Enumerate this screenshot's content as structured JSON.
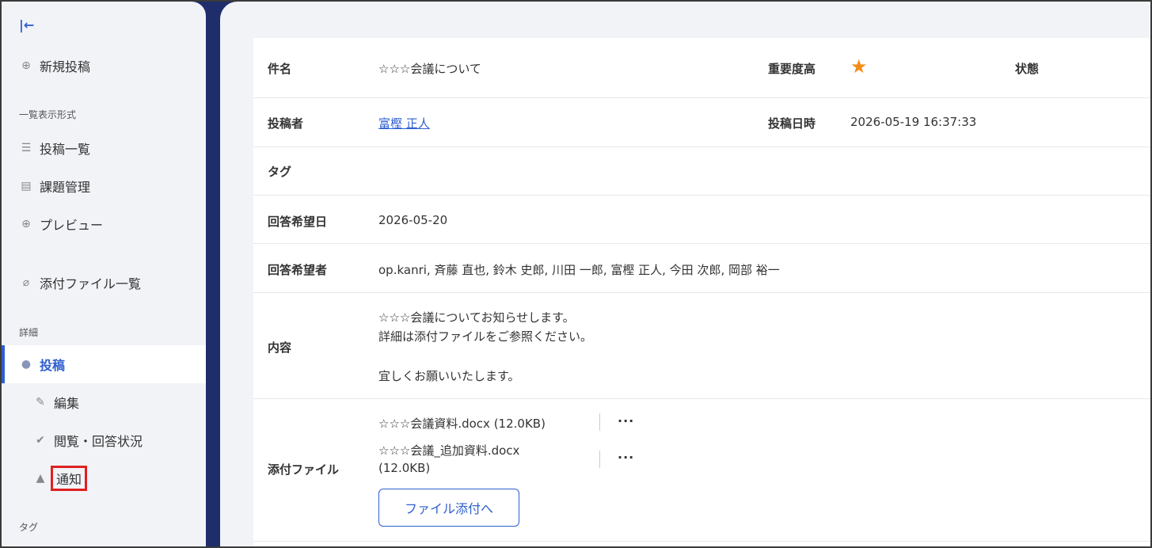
{
  "sidebar": {
    "collapse_icon": "collapse-left-icon",
    "new_post": "新規投稿",
    "section_list_format": "一覧表示形式",
    "post_list": "投稿一覧",
    "task_management": "課題管理",
    "preview": "プレビュー",
    "attachment_list": "添付ファイル一覧",
    "section_details": "詳細",
    "post": "投稿",
    "edit": "編集",
    "read_status": "閲覧・回答状況",
    "notification": "通知",
    "section_tags": "タグ"
  },
  "detail": {
    "subject_label": "件名",
    "subject_value": "☆☆☆会議について",
    "importance_label": "重要度高",
    "status_label": "状態",
    "poster_label": "投稿者",
    "poster_value": "富樫 正人",
    "post_datetime_label": "投稿日時",
    "post_datetime_value": "2026-05-19 16:37:33",
    "tag_label": "タグ",
    "due_date_label": "回答希望日",
    "due_date_value": "2026-05-20",
    "respondents_label": "回答希望者",
    "respondents_value": "op.kanri, 斉藤 直也, 鈴木 史郎, 川田 一郎, 富樫 正人, 今田 次郎, 岡部 裕一",
    "content_label": "内容",
    "content_line1": "☆☆☆会議についてお知らせします。",
    "content_line2": "詳細は添付ファイルをご参照ください。",
    "content_line3": "宜しくお願いいたします。",
    "attachment_label": "添付ファイル",
    "file1": "☆☆☆会議資料.docx (12.0KB)",
    "file2_line1": "☆☆☆会議_追加資料.docx",
    "file2_line2": "(12.0KB)",
    "more": "···",
    "attach_button": "ファイル添付へ"
  },
  "colors": {
    "accent": "#2f5fd0",
    "star": "#f28c1a",
    "highlight": "#e02020",
    "frame_bg": "#1f2d6b"
  }
}
